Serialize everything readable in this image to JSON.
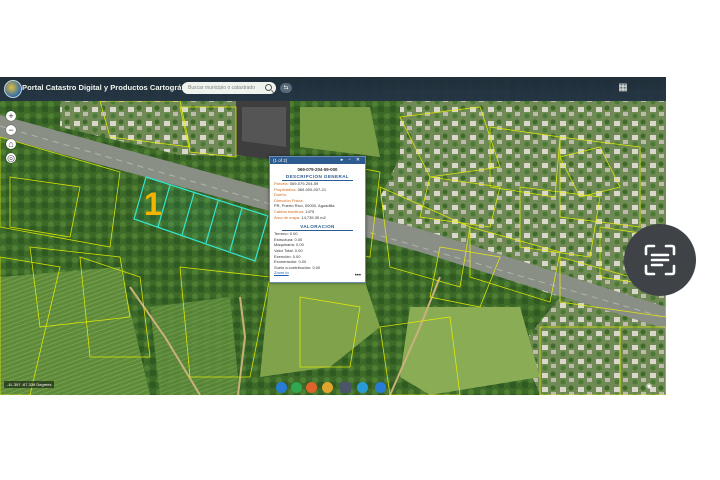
{
  "header": {
    "title": "Portal Catastro Digital y Productos Cartográficos",
    "search_placeholder": "Buscar municipio o catastrado"
  },
  "map": {
    "lot_label": "1",
    "coords": "-1L.397 -67.339 Degrees"
  },
  "popup": {
    "header": "(1 of 2)",
    "parcel_id": "069-079-204-59-000",
    "section1_title": "DESCRIPCION GENERAL",
    "section2_title": "VALORACION",
    "general_rows": [
      {
        "key": "Parcela:",
        "value": "069-079-204-59"
      },
      {
        "key": "Propietarios:",
        "value": "069-000-007-21"
      },
      {
        "key": "Dueño:",
        "value": ""
      },
      {
        "key": "Dirección Física:",
        "value": ""
      },
      {
        "key": "",
        "value": "PR, Puerto Rico, 00000, Aguadilla"
      },
      {
        "key": "Cabida escritura:",
        "value": "1475"
      },
      {
        "key": "Área de mapa:",
        "value": "14,735.35 m2"
      }
    ],
    "valoracion_rows": [
      {
        "key": "Terreno:",
        "value": "0.00"
      },
      {
        "key": "Estructura:",
        "value": "0.00"
      },
      {
        "key": "Maquinaria:",
        "value": "0.00"
      },
      {
        "key": "Valor Total:",
        "value": "0.00"
      },
      {
        "key": "Exención:",
        "value": "0.00"
      },
      {
        "key": "Exoneración:",
        "value": "0.00"
      },
      {
        "key": "Suelo a contribución:",
        "value": "0.00"
      }
    ],
    "link": "Zoom to",
    "more": "•••"
  },
  "colors": {
    "header_bg": "#1d2a3a",
    "popup_accent": "#2e5b8f",
    "parcel_outline": "#e8f000",
    "selected_outline": "#35e6d0",
    "lot_label": "#f5b400"
  },
  "icons": {
    "zoom_in": "+",
    "zoom_out": "−",
    "home": "⌂",
    "locate": "◎",
    "grid": "▦",
    "toggle": "⇆",
    "eye": "◉"
  }
}
